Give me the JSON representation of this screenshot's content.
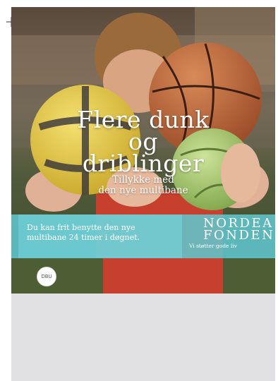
{
  "poster": {
    "headline": [
      "Flere dunk",
      "og",
      "driblinger"
    ],
    "subheadline": [
      "Tillykke med",
      "den nye multibane"
    ],
    "info": [
      "Du kan frit benytte den nye",
      "multibane 24 timer i døgnet."
    ],
    "brand": {
      "line1": "NORDEA",
      "line2": "FONDEN",
      "tagline": "Vi støtter gode liv"
    },
    "seal_text": "DBU"
  },
  "colors": {
    "band": "#5fc8d0",
    "gray_area": "#e1e1e3"
  }
}
